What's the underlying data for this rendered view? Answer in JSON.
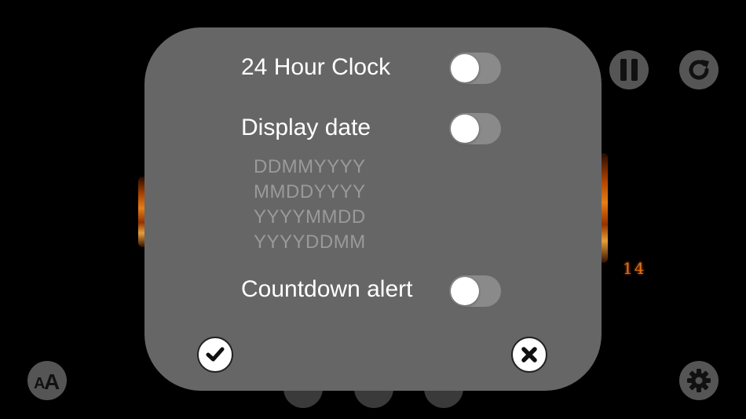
{
  "background": {
    "countdown_digits": "14"
  },
  "dialog": {
    "clock_24h": {
      "label": "24 Hour Clock",
      "on": false
    },
    "display_date": {
      "label": "Display date",
      "on": false
    },
    "date_formats": [
      "DDMMYYYY",
      "MMDDYYYY",
      "YYYYMMDD",
      "YYYYDDMM"
    ],
    "countdown_alert": {
      "label": "Countdown alert",
      "on": false
    },
    "confirm_icon": "checkmark-icon",
    "cancel_icon": "x-icon"
  },
  "icons": {
    "pause": "pause-icon",
    "reload": "reload-icon",
    "font": "font-size-icon",
    "settings": "gear-icon"
  },
  "colors": {
    "dialog_bg": "#666666",
    "toggle_off": "#8a8a8a",
    "format_text": "#9a9a9a",
    "fire": "#d6731b"
  }
}
